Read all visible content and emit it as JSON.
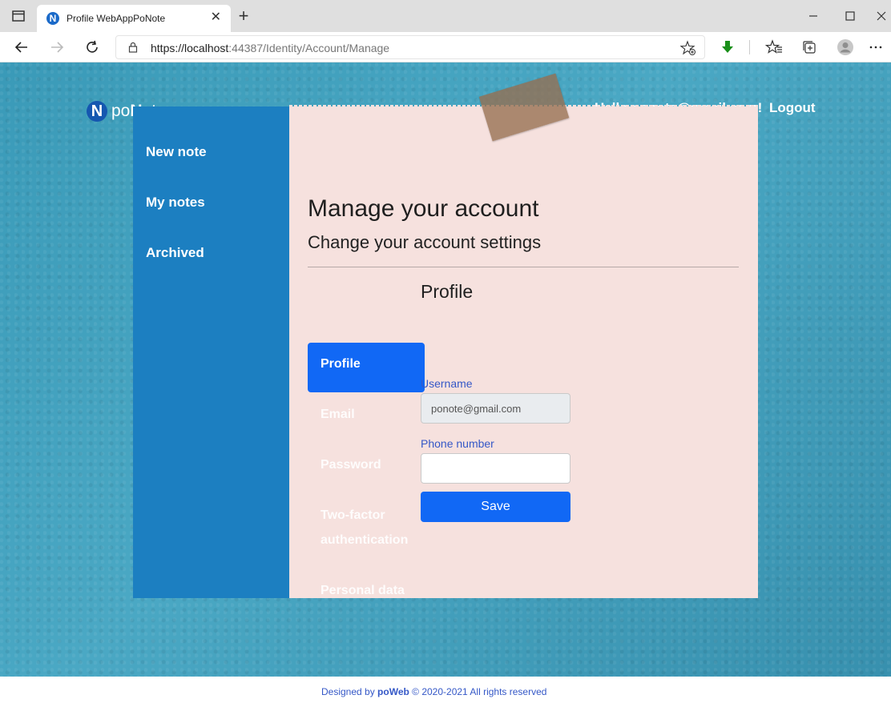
{
  "browser": {
    "tab_title": "Profile WebAppPoNote",
    "tab_favicon_letter": "N",
    "url_host": "https://localhost",
    "url_rest": ":44387/Identity/Account/Manage"
  },
  "header": {
    "logo_letter": "N",
    "logo_text_pre": "po",
    "logo_text_bold": "N",
    "logo_text_post": "ote",
    "greeting": "Hello ponote@gmail.com!",
    "logout": "Logout"
  },
  "sidebar": {
    "items": [
      {
        "label": "New note"
      },
      {
        "label": "My notes"
      },
      {
        "label": "Archived"
      }
    ]
  },
  "main": {
    "title": "Manage your account",
    "subtitle": "Change your account settings",
    "nav": [
      {
        "label": "Profile",
        "active": true
      },
      {
        "label": "Email",
        "active": false
      },
      {
        "label": "Password",
        "active": false
      },
      {
        "label": "Two-factor",
        "active": false
      },
      {
        "label": "authentication",
        "active": false
      },
      {
        "label": "Personal data",
        "active": false
      }
    ],
    "form": {
      "title": "Profile",
      "username_label": "Username",
      "username_value": "ponote@gmail.com",
      "phone_label": "Phone number",
      "phone_value": "",
      "save_label": "Save"
    }
  },
  "footer": {
    "prefix": "Designed by ",
    "brand": "poWeb",
    "suffix": " © 2020-2021 All rights reserved"
  },
  "colors": {
    "accent": "#1168f5",
    "sidebar": "#1c7fc1",
    "paper": "#f6e1de",
    "label": "#3558c7"
  }
}
